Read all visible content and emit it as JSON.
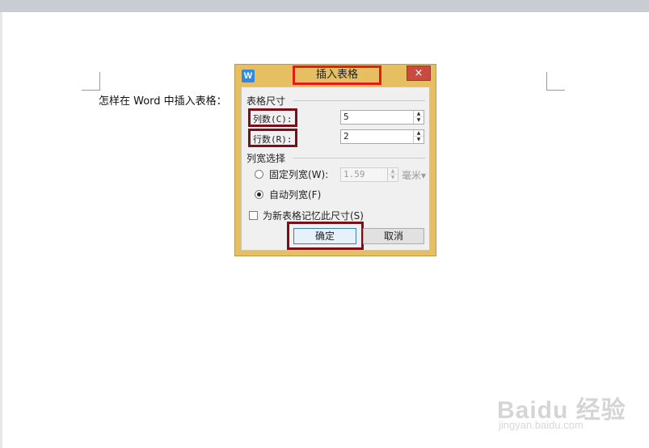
{
  "document": {
    "line_text": "怎样在 Word 中插入表格："
  },
  "dialog": {
    "icon_glyph": "W",
    "title": "插入表格",
    "close_glyph": "×",
    "size_group": {
      "label": "表格尺寸",
      "columns_label": "列数(C):",
      "columns_value": "5",
      "rows_label": "行数(R):",
      "rows_value": "2"
    },
    "width_group": {
      "label": "列宽选择",
      "fixed_label": "固定列宽(W):",
      "fixed_value": "1.59",
      "fixed_unit": "毫米▾",
      "fixed_selected": false,
      "auto_label": "自动列宽(F)",
      "auto_selected": true
    },
    "remember_label": "为新表格记忆此尺寸(S)",
    "remember_checked": false,
    "ok_label": "确定",
    "cancel_label": "取消",
    "spin_up_glyph": "▲",
    "spin_down_glyph": "▼",
    "highlight_colors": {
      "title": "#e21b1b",
      "fields": "#7a0e19"
    },
    "title_bar_color": "#e6bf63"
  },
  "watermark": {
    "logo": "Baidu 经验",
    "url": "jingyan.baidu.com"
  }
}
